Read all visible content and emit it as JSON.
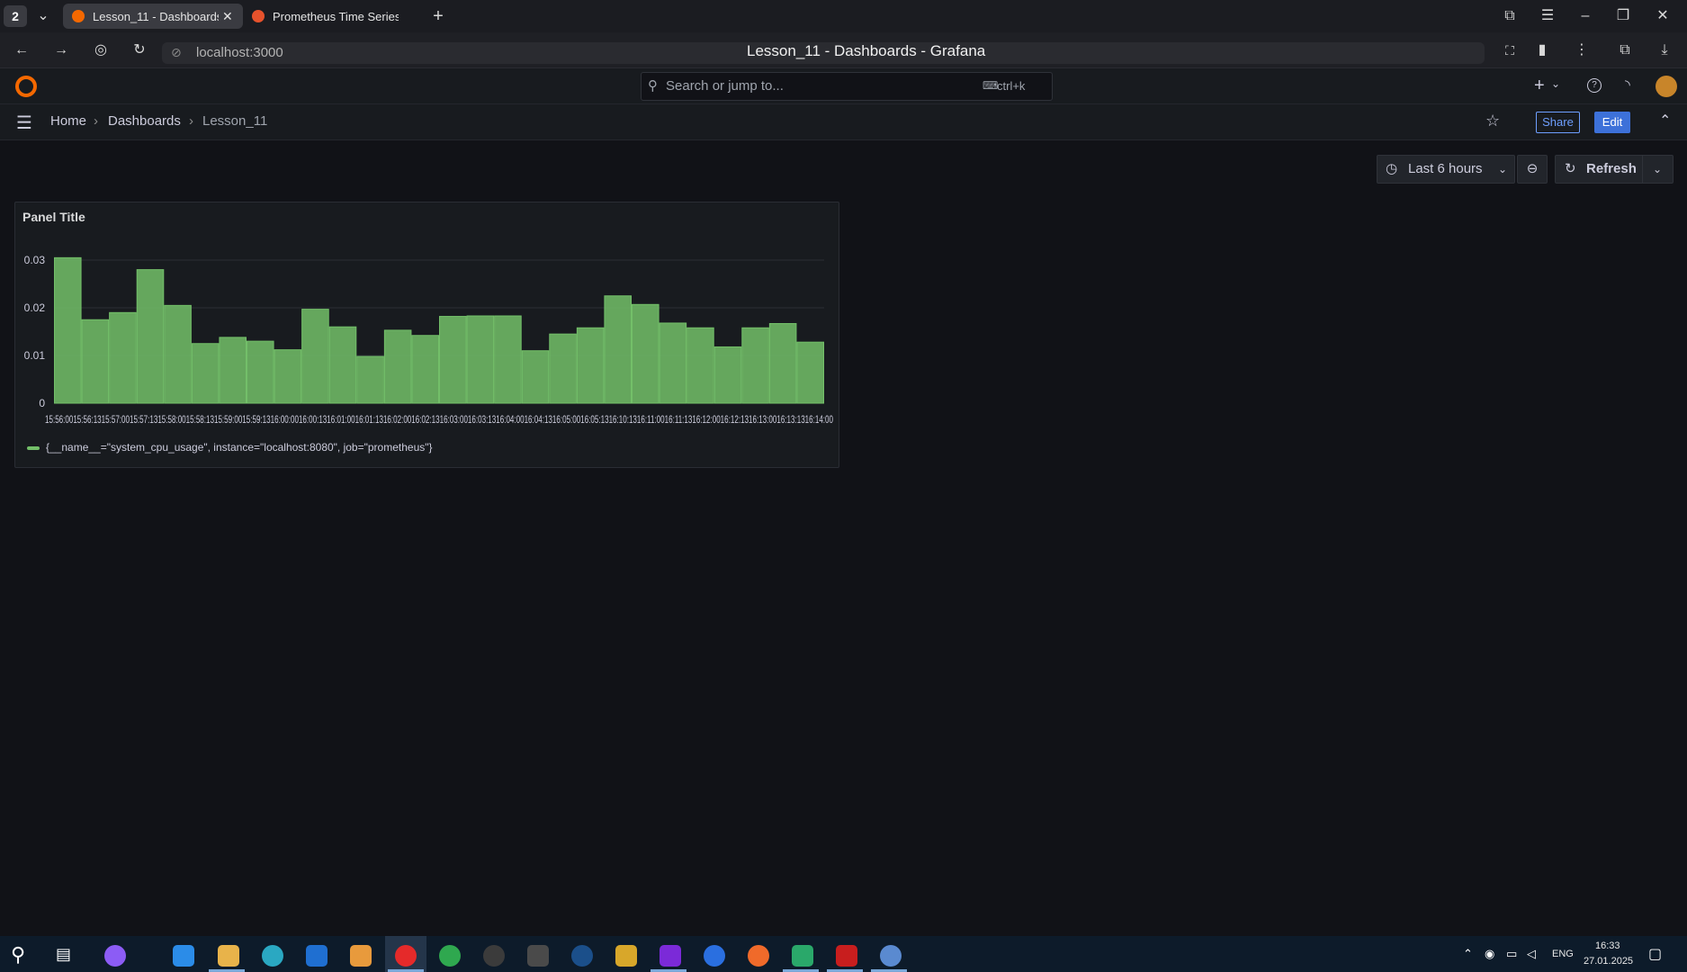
{
  "browser": {
    "tab_count": "2",
    "tabs": [
      {
        "label": "Lesson_11 - Dashboards",
        "active": true,
        "icon": "grafana-icon"
      },
      {
        "label": "Prometheus Time Series Co",
        "active": false,
        "icon": "prometheus-icon"
      }
    ],
    "url": "localhost:3000",
    "window_title": "Lesson_11 - Dashboards - Grafana"
  },
  "grafana": {
    "search_placeholder": "Search or jump to...",
    "search_shortcut": "ctrl+k",
    "breadcrumb": [
      "Home",
      "Dashboards",
      "Lesson_11"
    ],
    "share_label": "Share",
    "edit_label": "Edit",
    "time_range": "Last 6 hours",
    "refresh_label": "Refresh"
  },
  "panel": {
    "title": "Panel Title",
    "legend": "{__name__=\"system_cpu_usage\", instance=\"localhost:8080\", job=\"prometheus\"}"
  },
  "chart_data": {
    "type": "bar",
    "title": "Panel Title",
    "ylim": [
      0,
      0.03
    ],
    "yticks": [
      "0",
      "0.01",
      "0.02",
      "0.03"
    ],
    "series": [
      {
        "name": "{__name__=\"system_cpu_usage\", instance=\"localhost:8080\", job=\"prometheus\"}",
        "color": "#73bf69",
        "values": [
          0.0305,
          0.0175,
          0.019,
          0.028,
          0.0205,
          0.0125,
          0.0138,
          0.013,
          0.0112,
          0.0197,
          0.016,
          0.0098,
          0.0153,
          0.0142,
          0.0182,
          0.0183,
          0.0183,
          0.011,
          0.0145,
          0.0158,
          0.0225,
          0.0207,
          0.0168,
          0.0158,
          0.0118,
          0.0158,
          0.0167,
          0.0128
        ]
      }
    ],
    "categories": [
      "15:56",
      "15:56",
      "15:56",
      "15:57",
      "15:57",
      "15:58",
      "15:58",
      "15:59",
      "15:59",
      "16:00",
      "16:00",
      "16:01",
      "16:01",
      "16:02",
      "16:02",
      "16:03",
      "16:03",
      "16:04",
      "16:04",
      "16:05",
      "16:05",
      "16:10",
      "16:11",
      "16:11",
      "16:12",
      "16:12",
      "16:13",
      "16:14"
    ],
    "xtick_text": "15:56:0015:56:1315:57:0015:57:1315:58:0015:58:1315:59:0015:59:1316:00:0016:00:1316:01:0016:01:1316:02:0016:02:1316:03:0016:03:1316:04:0016:04:1316:05:0016:05:1316:10:1316:11:0016:11:1316:12:0016:12:1316:13:0016:13:1316:14:00",
    "grid": true,
    "legend": "bottom-left"
  },
  "taskbar": {
    "lang": "ENG",
    "time": "16:33",
    "date": "27.01.2025"
  }
}
